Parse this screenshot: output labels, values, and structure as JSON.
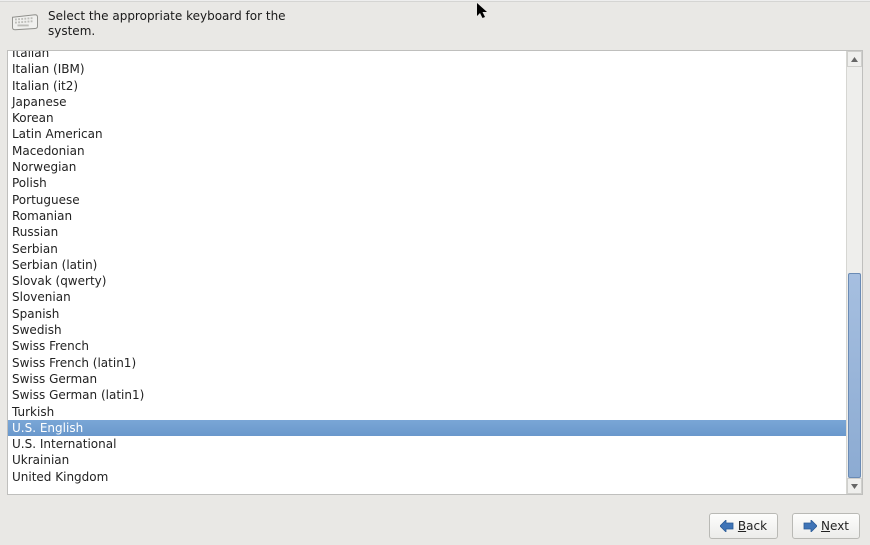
{
  "header": {
    "text": "Select the appropriate keyboard for the system."
  },
  "keyboards": [
    "Italian",
    "Italian (IBM)",
    "Italian (it2)",
    "Japanese",
    "Korean",
    "Latin American",
    "Macedonian",
    "Norwegian",
    "Polish",
    "Portuguese",
    "Romanian",
    "Russian",
    "Serbian",
    "Serbian (latin)",
    "Slovak (qwerty)",
    "Slovenian",
    "Spanish",
    "Swedish",
    "Swiss French",
    "Swiss French (latin1)",
    "Swiss German",
    "Swiss German (latin1)",
    "Turkish",
    "U.S. English",
    "U.S. International",
    "Ukrainian",
    "United Kingdom"
  ],
  "selected": "U.S. English",
  "buttons": {
    "back": {
      "mnemonic": "B",
      "rest": "ack"
    },
    "next": {
      "mnemonic": "N",
      "rest": "ext"
    }
  },
  "scrollbar": {
    "thumb_top_pct": 50,
    "thumb_height_pct": 50
  }
}
